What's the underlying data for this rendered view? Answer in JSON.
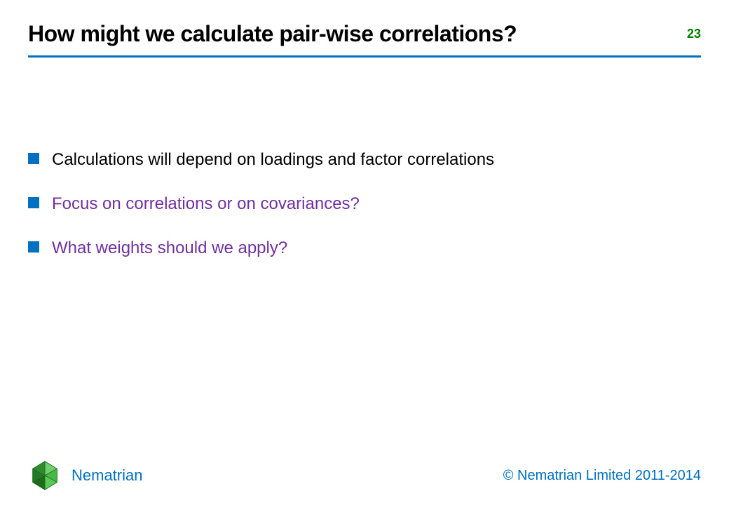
{
  "slide": {
    "title": "How might we calculate pair-wise correlations?",
    "number": "23"
  },
  "bullets": [
    {
      "text": "Calculations will depend on loadings and factor correlations",
      "style": "black"
    },
    {
      "text": "Focus on correlations or on covariances?",
      "style": "purple"
    },
    {
      "text": "What weights should we apply?",
      "style": "purple"
    }
  ],
  "footer": {
    "brand": "Nematrian",
    "copyright": "© Nematrian Limited 2011-2014"
  },
  "colors": {
    "accent_blue": "#0070c0",
    "number_green": "#008000",
    "emphasis_purple": "#7030a0"
  }
}
